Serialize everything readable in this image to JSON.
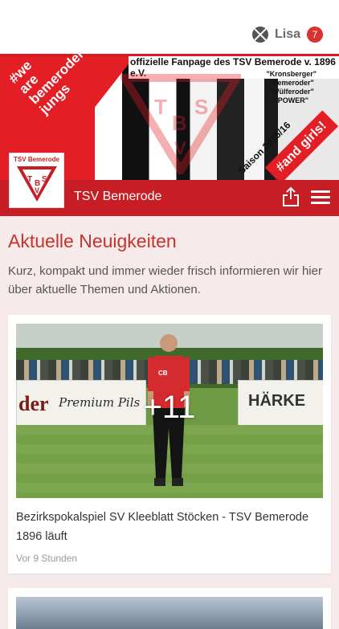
{
  "topbar": {
    "user_name": "Lisa",
    "notification_count": "7"
  },
  "banner": {
    "fanpage_text": "offizielle Fanpage des TSV Bemerode v. 1896 e.V.",
    "slogan": "#we\nare\nbemeroder\njungs",
    "quotes": [
      "\"Kronsberger\"",
      "\"Bemeroder\"",
      "\"Wülferoder\"",
      "\"POWER\""
    ],
    "season": "Saison 2015/16",
    "and_girls": "#and girls!"
  },
  "club": {
    "logo_label": "TSV Bemerode",
    "logo_letters": [
      "T",
      "B",
      "S",
      "V"
    ],
    "title": "TSV Bemerode"
  },
  "main": {
    "heading": "Aktuelle Neuigkeiten",
    "intro": "Kurz, kompakt und immer wieder frisch informieren wir hier über aktuelle Themen und Aktionen."
  },
  "news": [
    {
      "image_count": "+11",
      "board_left_1": "der",
      "board_left_2": "Premium Pils",
      "board_right": "HÄRKE",
      "player_shirt": "CB",
      "headline": "Bezirkspokalspiel SV Kleeblatt Stöcken - TSV Bemerode 1896 läuft",
      "time": "Vor 9 Stunden"
    }
  ],
  "colors": {
    "brand_red": "#c71d25",
    "heading_red": "#c6332d",
    "page_bg": "#f7eaea",
    "badge_red": "#d9322f"
  },
  "icons": {
    "app": "app-logo-icon",
    "share": "share-icon",
    "menu": "hamburger-menu-icon"
  }
}
